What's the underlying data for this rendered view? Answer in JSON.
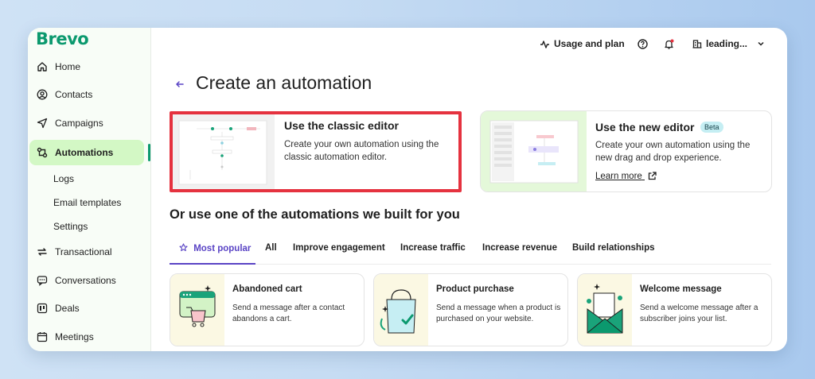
{
  "sidebar": {
    "brand": "Brevo",
    "items": [
      {
        "label": "Home",
        "icon": "home-icon"
      },
      {
        "label": "Contacts",
        "icon": "contacts-icon"
      },
      {
        "label": "Campaigns",
        "icon": "send-icon"
      },
      {
        "label": "Automations",
        "icon": "automation-icon"
      },
      {
        "label": "Transactional",
        "icon": "transactional-icon"
      },
      {
        "label": "Conversations",
        "icon": "chat-icon"
      },
      {
        "label": "Deals",
        "icon": "deals-icon"
      },
      {
        "label": "Meetings",
        "icon": "calendar-icon"
      }
    ],
    "sub_items": [
      "Logs",
      "Email templates",
      "Settings"
    ]
  },
  "topbar": {
    "usage": "Usage and plan",
    "account": "leading..."
  },
  "page": {
    "title": "Create an automation"
  },
  "editors": {
    "classic": {
      "title": "Use the classic editor",
      "desc": "Create your own automation using the classic automation editor."
    },
    "new": {
      "title": "Use the new editor",
      "badge": "Beta",
      "desc": "Create your own automation using the new drag and drop experience.",
      "link": "Learn more"
    }
  },
  "section": {
    "title": "Or use one of the automations we built for you"
  },
  "tabs": [
    "Most popular",
    "All",
    "Improve engagement",
    "Increase traffic",
    "Increase revenue",
    "Build relationships"
  ],
  "automations": [
    {
      "title": "Abandoned cart",
      "desc": "Send a message after a contact abandons a cart."
    },
    {
      "title": "Product purchase",
      "desc": "Send a message when a product is purchased on your website."
    },
    {
      "title": "Welcome message",
      "desc": "Send a welcome message after a subscriber joins your list."
    }
  ],
  "colors": {
    "brand": "#0b996e",
    "active_nav": "#d3f8c5",
    "accent": "#5a44c5",
    "highlight": "#e5323f"
  }
}
